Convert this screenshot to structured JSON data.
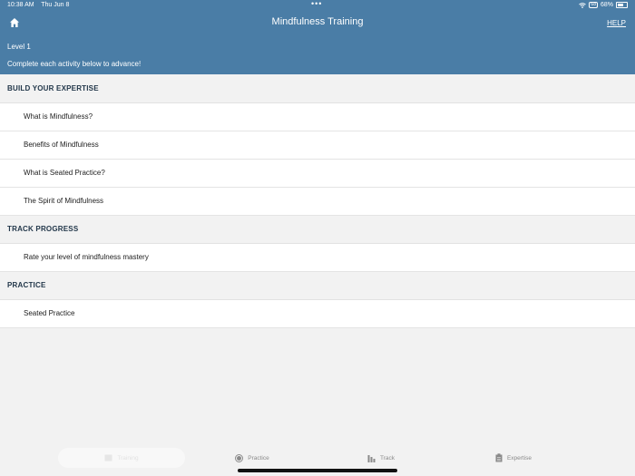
{
  "status": {
    "time": "10:38 AM",
    "date": "Thu Jun 8",
    "dots": "•••",
    "battery_pct": "68%",
    "battery_box": "68"
  },
  "nav": {
    "title": "Mindfulness Training",
    "help": "HELP",
    "home_icon": "home-icon"
  },
  "level": {
    "title": "Level 1",
    "subtitle": "Complete each activity below to advance!"
  },
  "sections": [
    {
      "header": "BUILD YOUR EXPERTISE",
      "items": [
        "What is Mindfulness?",
        "Benefits of Mindfulness",
        "What is Seated Practice?",
        "The Spirit of Mindfulness"
      ]
    },
    {
      "header": "TRACK PROGRESS",
      "items": [
        "Rate your level of mindfulness mastery"
      ]
    },
    {
      "header": "PRACTICE",
      "items": [
        "Seated Practice"
      ]
    }
  ],
  "tabs": [
    {
      "label": "Training",
      "icon": "book-icon",
      "active": true
    },
    {
      "label": "Practice",
      "icon": "circle-icon",
      "active": false
    },
    {
      "label": "Track",
      "icon": "bar-chart-icon",
      "active": false
    },
    {
      "label": "Expertise",
      "icon": "clipboard-icon",
      "active": false
    }
  ],
  "colors": {
    "header_blue": "#4a7da6",
    "background": "#f2f2f2",
    "section_text": "#22374a"
  }
}
